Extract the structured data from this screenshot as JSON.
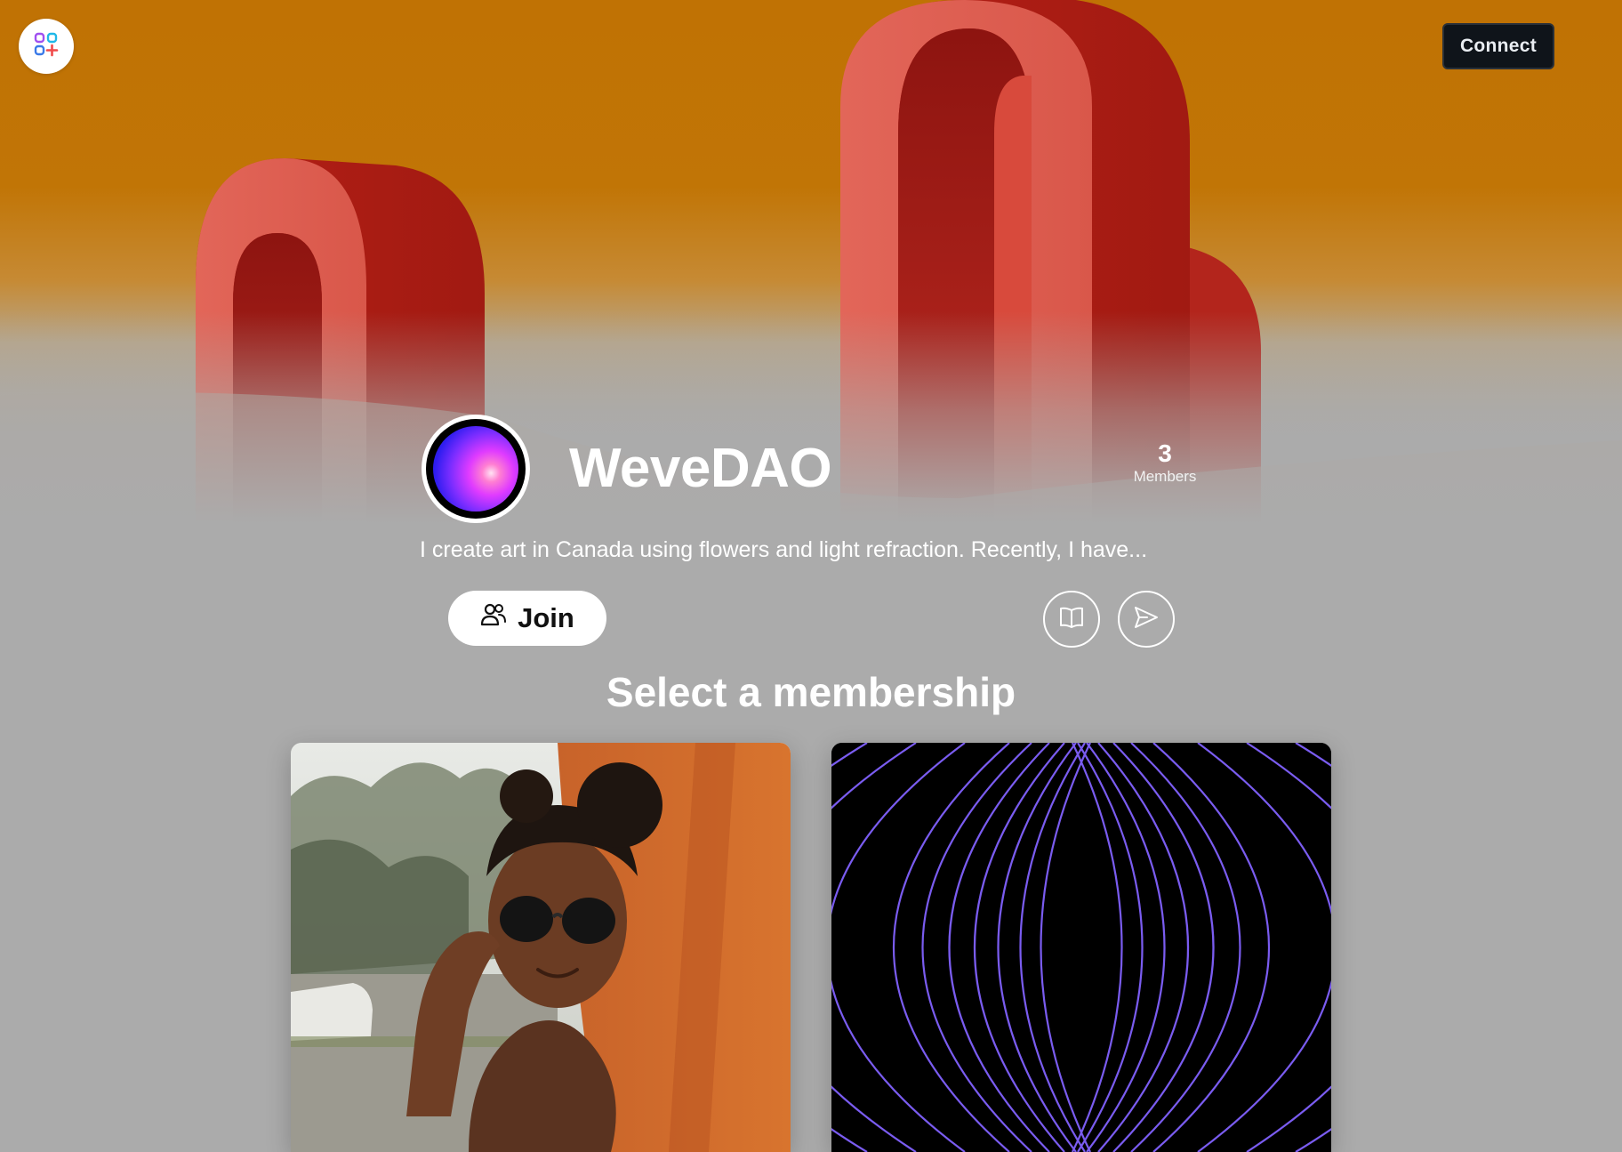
{
  "header": {
    "logo_icon": "app-grid-plus-icon",
    "connect_label": "Connect"
  },
  "profile": {
    "name": "WeveDAO",
    "members_count": "3",
    "members_label": "Members",
    "description": "I create art in Canada using flowers and light refraction. Recently, I have...",
    "join_label": "Join",
    "docs_icon": "book-icon",
    "share_icon": "send-icon"
  },
  "memberships": {
    "title": "Select a membership",
    "cards": [
      {
        "image": "photo-woman-sunglasses"
      },
      {
        "image": "purple-concentric-arcs"
      }
    ]
  },
  "colors": {
    "hero_orange": "#c07204",
    "arch_red": "#c8231a",
    "page_gray": "#ababab",
    "arc_purple": "#7a5cf0"
  }
}
